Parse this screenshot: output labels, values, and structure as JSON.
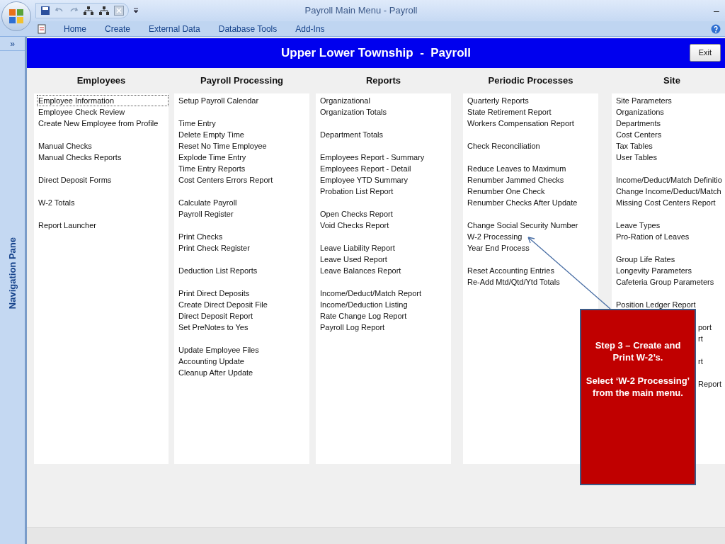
{
  "window": {
    "title": "Payroll Main Menu - Payroll",
    "minimize": "–"
  },
  "ribbon": {
    "tabs": [
      {
        "label": "Home",
        "selected": false
      },
      {
        "label": "Create",
        "selected": false
      },
      {
        "label": "External Data",
        "selected": false
      },
      {
        "label": "Database Tools",
        "selected": false
      },
      {
        "label": "Add-Ins",
        "selected": false
      }
    ]
  },
  "navigation_pane": {
    "toggle": "»",
    "label": "Navigation Pane"
  },
  "form": {
    "title": "Upper Lower Township  -  Payroll",
    "exit_button": "Exit",
    "columns": [
      {
        "heading": "Employees",
        "groups": [
          [
            {
              "text": "Employee Information",
              "selected": true
            },
            {
              "text": "Employee Check Review",
              "selected": false
            },
            {
              "text": "Create New Employee from Profile",
              "selected": false
            }
          ],
          [
            {
              "text": "Manual Checks",
              "selected": false
            },
            {
              "text": "Manual Checks Reports",
              "selected": false
            }
          ],
          [
            {
              "text": "Direct Deposit Forms",
              "selected": false
            }
          ],
          [
            {
              "text": "W-2 Totals",
              "selected": false
            }
          ],
          [
            {
              "text": "Report Launcher",
              "selected": false
            }
          ]
        ]
      },
      {
        "heading": "Payroll Processing",
        "groups": [
          [
            {
              "text": "Setup Payroll Calendar",
              "selected": false
            }
          ],
          [
            {
              "text": "Time Entry",
              "selected": false
            },
            {
              "text": "Delete Empty Time",
              "selected": false
            },
            {
              "text": "Reset No Time Employee",
              "selected": false
            },
            {
              "text": "Explode Time Entry",
              "selected": false
            },
            {
              "text": "Time Entry Reports",
              "selected": false
            },
            {
              "text": "Cost Centers Errors Report",
              "selected": false
            }
          ],
          [
            {
              "text": "Calculate Payroll",
              "selected": false
            },
            {
              "text": "Payroll Register",
              "selected": false
            }
          ],
          [
            {
              "text": "Print Checks",
              "selected": false
            },
            {
              "text": "Print Check Register",
              "selected": false
            }
          ],
          [
            {
              "text": "Deduction List Reports",
              "selected": false
            }
          ],
          [
            {
              "text": "Print Direct Deposits",
              "selected": false
            },
            {
              "text": "Create Direct Deposit File",
              "selected": false
            },
            {
              "text": "Direct Deposit Report",
              "selected": false
            },
            {
              "text": "Set PreNotes to Yes",
              "selected": false
            }
          ],
          [
            {
              "text": "Update Employee Files",
              "selected": false
            },
            {
              "text": "Accounting Update",
              "selected": false
            },
            {
              "text": "Cleanup After Update",
              "selected": false
            }
          ]
        ]
      },
      {
        "heading": "Reports",
        "groups": [
          [
            {
              "text": "Organizational",
              "selected": false
            },
            {
              "text": "Organization Totals",
              "selected": false
            }
          ],
          [
            {
              "text": "Department Totals",
              "selected": false
            }
          ],
          [
            {
              "text": "Employees Report - Summary",
              "selected": false
            },
            {
              "text": "Employees Report - Detail",
              "selected": false
            },
            {
              "text": "Employee YTD Summary",
              "selected": false
            },
            {
              "text": "Probation List Report",
              "selected": false
            }
          ],
          [
            {
              "text": "Open Checks Report",
              "selected": false
            },
            {
              "text": "Void Checks Report",
              "selected": false
            }
          ],
          [
            {
              "text": "Leave Liability Report",
              "selected": false
            },
            {
              "text": "Leave Used Report",
              "selected": false
            },
            {
              "text": "Leave Balances Report",
              "selected": false
            }
          ],
          [
            {
              "text": "Income/Deduct/Match Report",
              "selected": false
            },
            {
              "text": "Income/Deduction Listing",
              "selected": false
            },
            {
              "text": "Rate Change Log Report",
              "selected": false
            },
            {
              "text": "Payroll Log Report",
              "selected": false
            }
          ]
        ]
      },
      {
        "heading": "Periodic Processes",
        "groups": [
          [
            {
              "text": "Quarterly Reports",
              "selected": false
            },
            {
              "text": "State Retirement Report",
              "selected": false
            },
            {
              "text": "Workers Compensation Report",
              "selected": false
            }
          ],
          [
            {
              "text": "Check Reconciliation",
              "selected": false
            }
          ],
          [
            {
              "text": "Reduce Leaves to Maximum",
              "selected": false
            },
            {
              "text": "Renumber Jammed Checks",
              "selected": false
            },
            {
              "text": "Renumber One Check",
              "selected": false
            },
            {
              "text": "Renumber Checks After Update",
              "selected": false
            }
          ],
          [
            {
              "text": "Change Social Security Number",
              "selected": false
            },
            {
              "text": "W-2 Processing",
              "selected": false
            },
            {
              "text": "Year End Process",
              "selected": false
            }
          ],
          [
            {
              "text": "Reset Accounting Entries",
              "selected": false
            },
            {
              "text": "Re-Add Mtd/Qtd/Ytd Totals",
              "selected": false
            }
          ]
        ]
      },
      {
        "heading": "Site",
        "groups": [
          [
            {
              "text": "Site Parameters",
              "selected": false
            },
            {
              "text": "Organizations",
              "selected": false
            },
            {
              "text": "Departments",
              "selected": false
            },
            {
              "text": "Cost Centers",
              "selected": false
            },
            {
              "text": "Tax Tables",
              "selected": false
            },
            {
              "text": "User Tables",
              "selected": false
            }
          ],
          [
            {
              "text": "Income/Deduct/Match Definitio",
              "selected": false
            },
            {
              "text": "Change Income/Deduct/Match",
              "selected": false
            },
            {
              "text": "Missing Cost Centers Report",
              "selected": false
            }
          ],
          [
            {
              "text": "Leave Types",
              "selected": false
            },
            {
              "text": "Pro-Ration of Leaves",
              "selected": false
            }
          ],
          [
            {
              "text": "Group Life Rates",
              "selected": false
            },
            {
              "text": "Longevity Parameters",
              "selected": false
            },
            {
              "text": "Cafeteria Group Parameters",
              "selected": false
            }
          ],
          [
            {
              "text": "Position Ledger Report",
              "selected": false
            }
          ]
        ],
        "covered_groups": [
          [
            "port",
            "rt"
          ],
          [
            "rt"
          ],
          [
            "Report"
          ]
        ]
      }
    ]
  },
  "callout": {
    "paragraphs": [
      "Step 3 – Create and Print W-2’s.",
      "Select ‘W-2 Processing’ from the main menu."
    ]
  }
}
